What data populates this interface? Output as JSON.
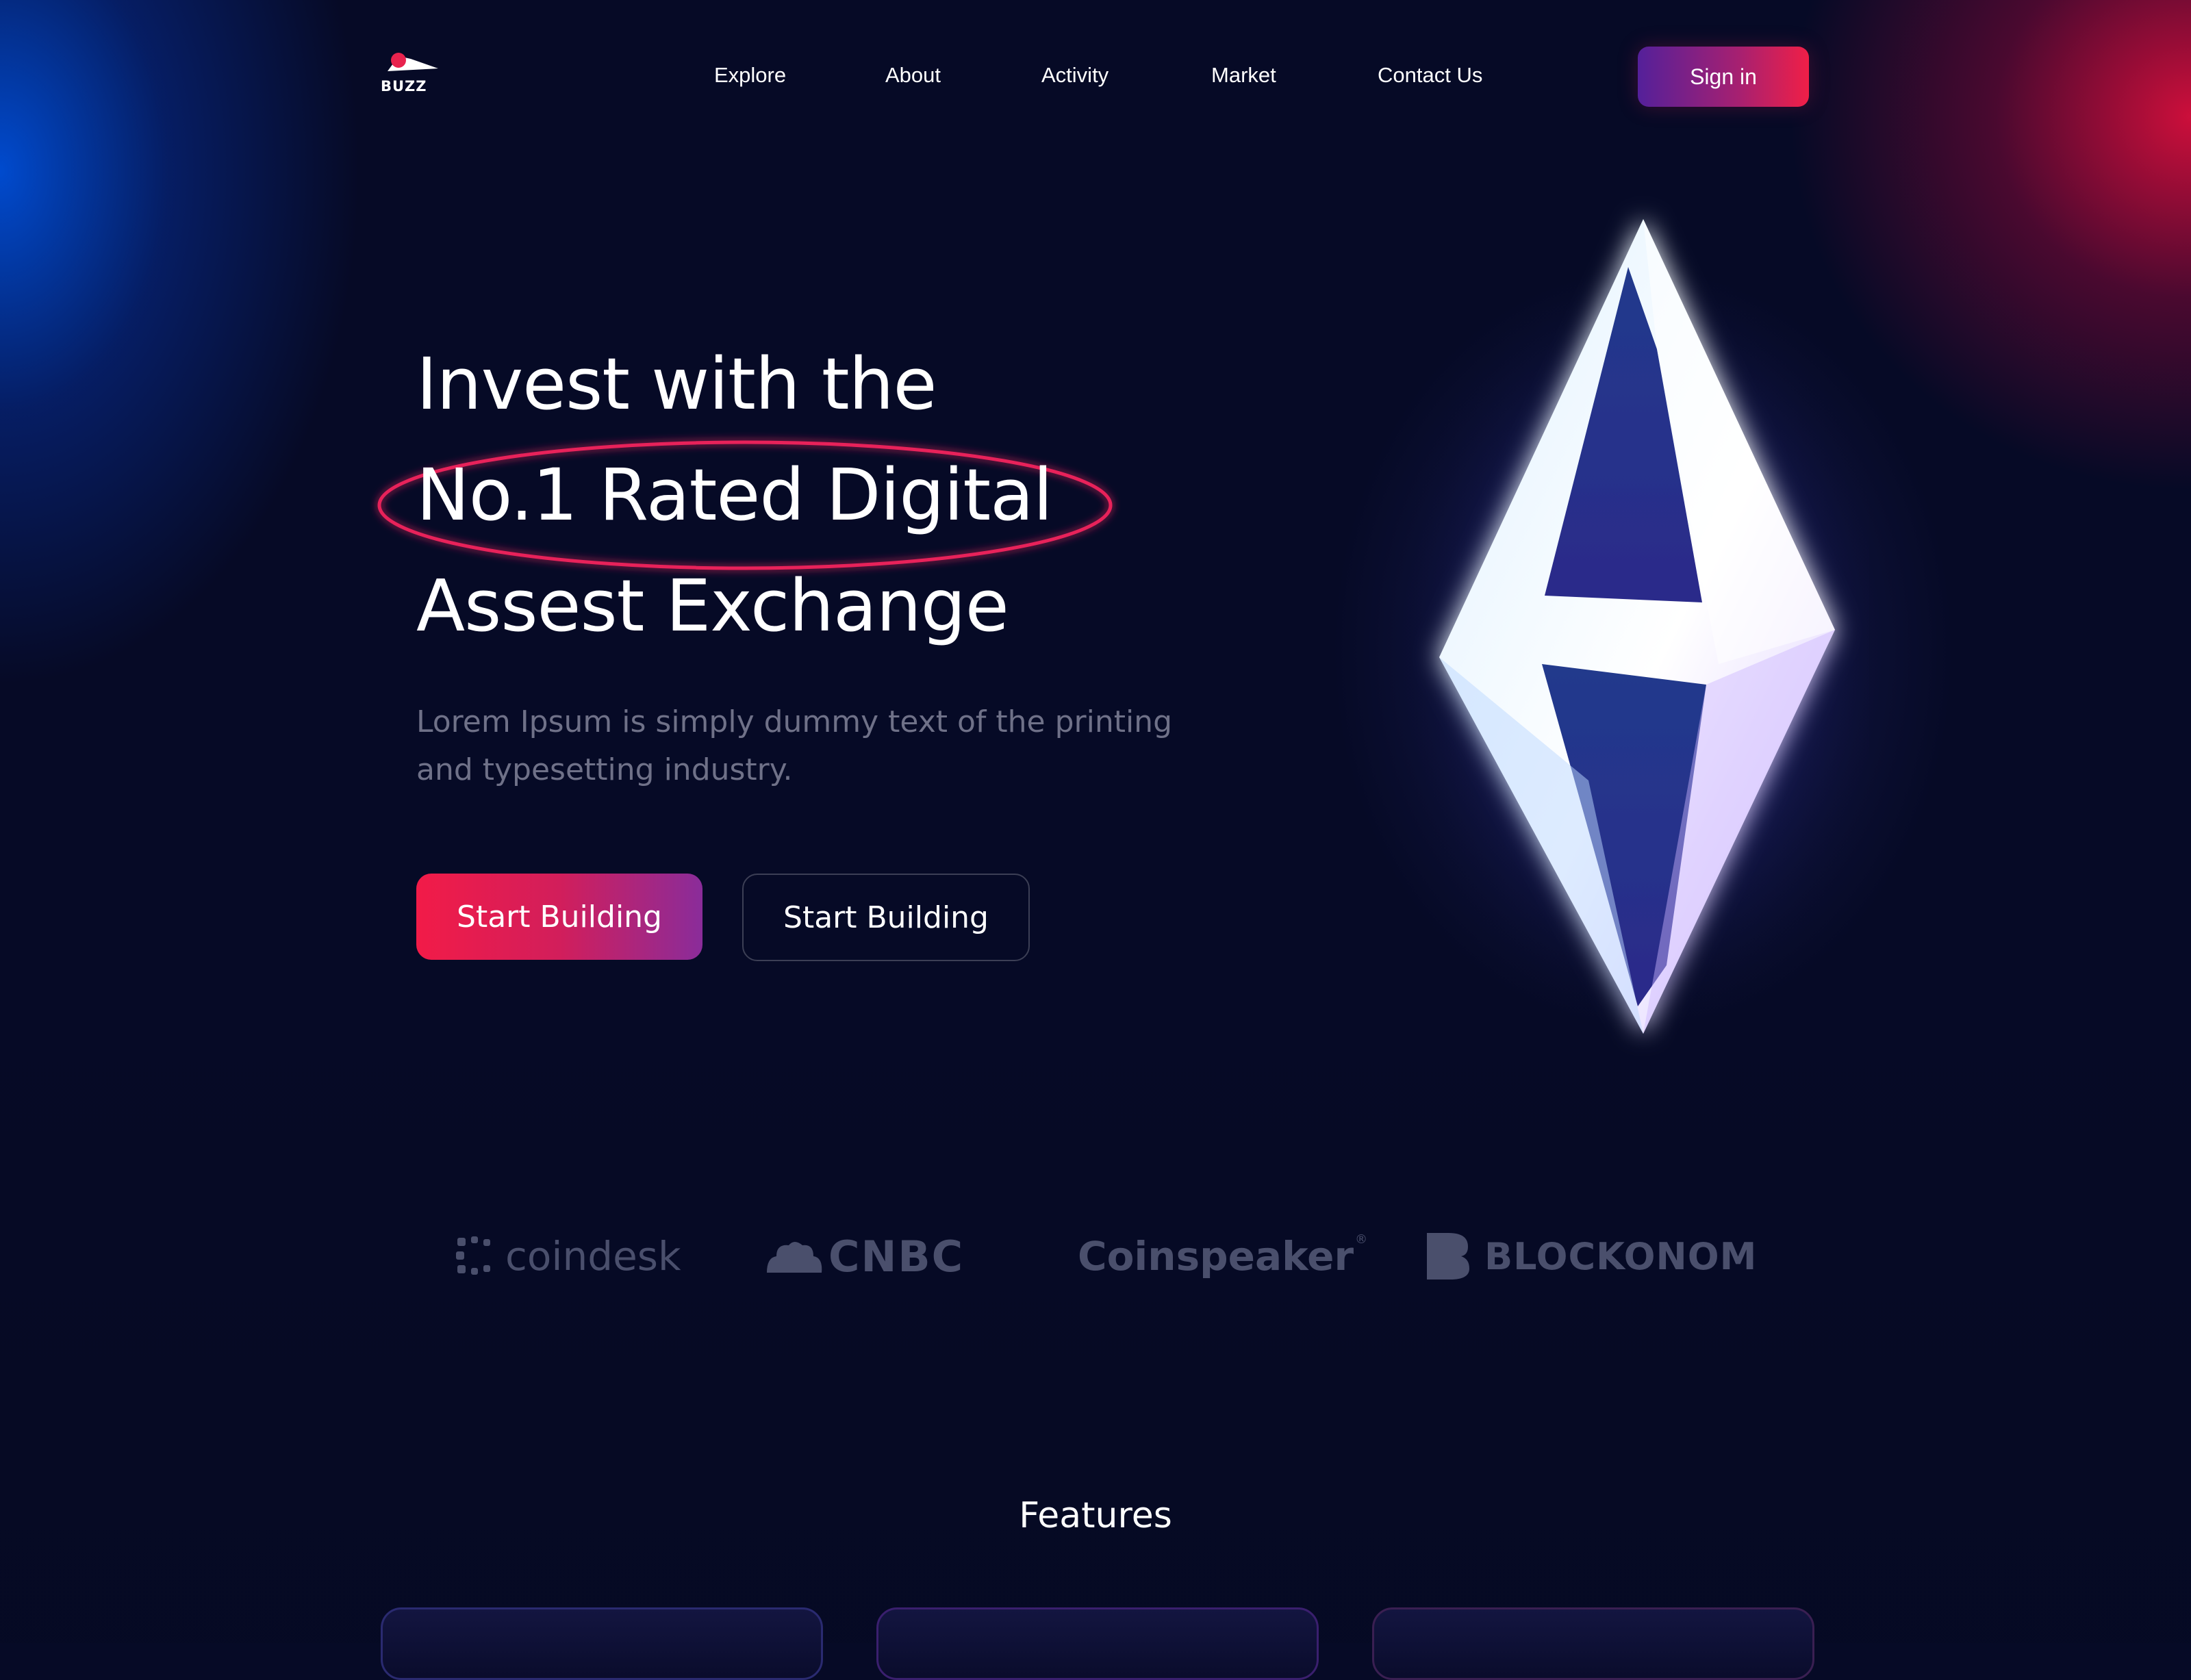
{
  "brand": {
    "name": "BUZZ"
  },
  "nav": {
    "items": [
      "Explore",
      "About",
      "Activity",
      "Market",
      "Contact Us"
    ],
    "signin_label": "Sign in"
  },
  "hero": {
    "title_line1": "Invest with the",
    "title_line2": "No.1 Rated Digital",
    "title_line3": "Assest Exchange",
    "subtitle_line1": "Lorem Ipsum is simply dummy text of the printing",
    "subtitle_line2": "and typesetting industry.",
    "primary_cta": "Start Building",
    "secondary_cta": "Start Building"
  },
  "press": [
    "coindesk",
    "CNBC",
    "Coinspeaker",
    "BLOCKONOM"
  ],
  "features": {
    "title": "Features"
  },
  "colors": {
    "accent": "#f21b48",
    "background": "#060a26",
    "brand_purple": "#54209a",
    "muted_text": "#6f7188"
  }
}
